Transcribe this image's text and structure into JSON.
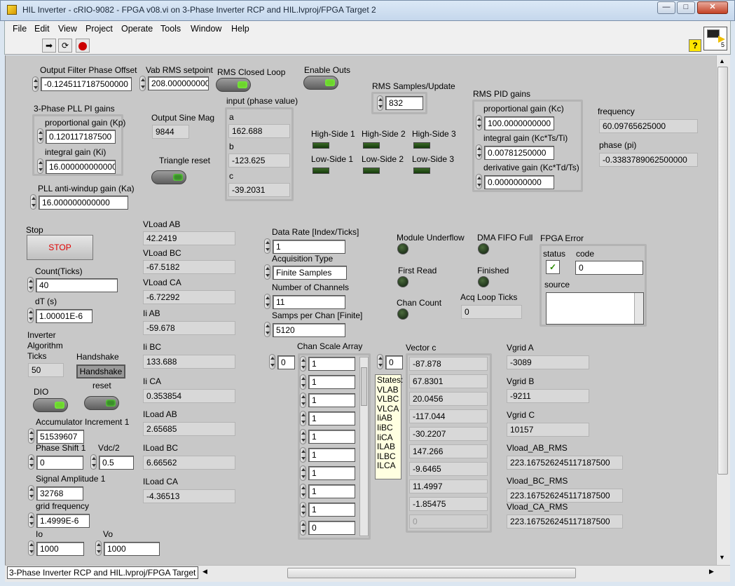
{
  "window": {
    "title": "HIL Inverter - cRIO-9082 - FPGA v08.vi on 3-Phase Inverter RCP and HIL.lvproj/FPGA Target 2",
    "minimize": "—",
    "maximize": "□",
    "close": "✕"
  },
  "menu": [
    "File",
    "Edit",
    "View",
    "Project",
    "Operate",
    "Tools",
    "Window",
    "Help"
  ],
  "toolbar": {
    "run_icon": "run-arrow-icon",
    "continuous_icon": "run-continuously-icon",
    "abort_icon": "abort-icon",
    "help": "?",
    "vi_icon_text": "5"
  },
  "status_path": "3-Phase Inverter RCP and HIL.lvproj/FPGA Target 2",
  "controls": {
    "output_filter_phase_offset": {
      "label": "Output Filter Phase Offset",
      "value": "-0.1245117187500000"
    },
    "vab_rms_setpoint": {
      "label": "Vab RMS setpoint",
      "value": "208.000000000"
    },
    "rms_closed_loop": {
      "label": "RMS Closed Loop"
    },
    "enable_outs": {
      "label": "Enable Outs"
    },
    "rms_samples_update": {
      "label": "RMS Samples/Update",
      "value": "832"
    },
    "pll_gains": {
      "label": "3-Phase PLL PI gains",
      "kp_label": "proportional gain (Kp)",
      "kp": "0.120117187500",
      "ki_label": "integral gain (Ki)",
      "ki": "16.000000000000"
    },
    "pll_antiwindup": {
      "label": "PLL anti-windup gain (Ka)",
      "value": "16.000000000000"
    },
    "output_sine_mag": {
      "label": "Output Sine Mag",
      "value": "9844"
    },
    "triangle_reset": {
      "label": "Triangle reset"
    },
    "input_phase": {
      "label": "input (phase value)",
      "a_label": "a",
      "a": "162.688",
      "b_label": "b",
      "b": "-123.625",
      "c_label": "c",
      "c": "-39.2031"
    },
    "high_low_side": {
      "labels": [
        "High-Side 1",
        "High-Side 2",
        "High-Side 3",
        "Low-Side 1",
        "Low-Side 2",
        "Low-Side 3"
      ]
    },
    "rms_pid": {
      "label": "RMS PID gains",
      "kc_label": "proportional gain (Kc)",
      "kc": "100.0000000000",
      "ti_label": "integral gain (Kc*Ts/Ti)",
      "ti": "0.00781250000",
      "td_label": "derivative gain (Kc*Td/Ts)",
      "td": "0.0000000000"
    },
    "frequency": {
      "label": "frequency",
      "value": "60.09765625000"
    },
    "phase_pi": {
      "label": "phase (pi)",
      "value": "-0.3383789062500000"
    },
    "stop": {
      "label": "Stop",
      "button": "STOP"
    },
    "count_ticks": {
      "label": "Count(Ticks)",
      "value": "40"
    },
    "dt": {
      "label": "dT (s)",
      "value": "1.00001E-6"
    },
    "inverter_ticks": {
      "label_lines": [
        "Inverter",
        "Algorithm",
        "Ticks"
      ],
      "value": "50"
    },
    "handshake": {
      "label": "Handshake",
      "button": "Handshake",
      "reset_label": "reset"
    },
    "dio": {
      "label": "DIO"
    },
    "accumulator": {
      "label": "Accumulator Increment 1",
      "value": "51539607"
    },
    "phase_shift": {
      "label": "Phase Shift 1",
      "value": "0"
    },
    "vdc2": {
      "label": "Vdc/2",
      "value": "0.5"
    },
    "signal_amplitude": {
      "label": "Signal Amplitude 1",
      "value": "32768"
    },
    "grid_frequency": {
      "label": "grid frequency",
      "value": "1.4999E-6"
    },
    "io": {
      "label": "Io",
      "value": "1000"
    },
    "vo": {
      "label": "Vo",
      "value": "1000"
    },
    "vload_ab": {
      "label": "VLoad AB",
      "value": "42.2419"
    },
    "vload_bc": {
      "label": "VLoad BC",
      "value": "-67.5182"
    },
    "vload_ca": {
      "label": "VLoad CA",
      "value": "-6.72292"
    },
    "ii_ab": {
      "label": "Ii AB",
      "value": "-59.678"
    },
    "ii_bc": {
      "label": "Ii BC",
      "value": "133.688"
    },
    "ii_ca": {
      "label": "Ii CA",
      "value": "0.353854"
    },
    "iload_ab": {
      "label": "ILoad AB",
      "value": "2.65685"
    },
    "iload_bc": {
      "label": "ILoad BC",
      "value": "6.66562"
    },
    "iload_ca": {
      "label": "ILoad CA",
      "value": "-4.36513"
    },
    "data_rate": {
      "label": "Data Rate [Index/Ticks]",
      "value": "1"
    },
    "acq_type": {
      "label": "Acquisition Type",
      "value": "Finite Samples"
    },
    "num_channels": {
      "label": "Number of Channels",
      "value": "11"
    },
    "samps_per_chan": {
      "label": "Samps per Chan [Finite]",
      "value": "5120"
    },
    "module_underflow": {
      "label": "Module Underflow"
    },
    "dma_fifo_full": {
      "label": "DMA FIFO Full"
    },
    "first_read": {
      "label": "First Read"
    },
    "finished": {
      "label": "Finished"
    },
    "chan_count": {
      "label": "Chan Count"
    },
    "acq_loop_ticks": {
      "label": "Acq Loop Ticks",
      "value": "0"
    },
    "fpga_error": {
      "label": "FPGA Error",
      "status_label": "status",
      "code_label": "code",
      "code": "0",
      "source_label": "source",
      "check": "✓"
    },
    "chan_scale_array": {
      "label": "Chan Scale Array",
      "index": "0",
      "values": [
        "1",
        "1",
        "1",
        "1",
        "1",
        "1",
        "1",
        "1",
        "1",
        "0"
      ]
    },
    "vector_c": {
      "label": "Vector c",
      "index": "0",
      "values": [
        "-87.878",
        "67.8301",
        "20.0456",
        "-117.044",
        "-30.2207",
        "147.266",
        "-9.6465",
        "11.4997",
        "-1.85475",
        "0"
      ]
    },
    "states": {
      "title": "States:",
      "items": [
        "VLAB",
        "VLBC",
        "VLCA",
        "IiAB",
        "IiBC",
        "IiCA",
        "ILAB",
        "ILBC",
        "ILCA"
      ]
    },
    "vgrid_a": {
      "label": "Vgrid A",
      "value": "-3089"
    },
    "vgrid_b": {
      "label": "Vgrid B",
      "value": "-9211"
    },
    "vgrid_c": {
      "label": "Vgrid C",
      "value": "10157"
    },
    "vload_ab_rms": {
      "label": "Vload_AB_RMS",
      "value": "223.167526245117187500"
    },
    "vload_bc_rms": {
      "label": "Vload_BC_RMS",
      "value": "223.167526245117187500"
    },
    "vload_ca_rms": {
      "label": "Vload_CA_RMS",
      "value": "223.167526245117187500"
    }
  }
}
